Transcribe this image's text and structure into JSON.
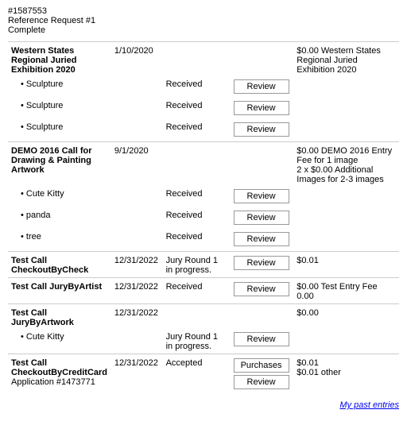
{
  "header": {
    "id": "#1587553",
    "reference": "Reference Request #1",
    "status": "Complete"
  },
  "entries": [
    {
      "id": "entry-western",
      "call_name": "Western States Regional Juried Exhibition 2020",
      "date": "1/10/2020",
      "status": "",
      "amount": "$0.00 Western States Regional Juried Exhibition 2020",
      "artworks": [
        {
          "name": "Sculpture",
          "status": "Received",
          "has_review": true
        },
        {
          "name": "Sculpture",
          "status": "Received",
          "has_review": true
        },
        {
          "name": "Sculpture",
          "status": "Received",
          "has_review": true
        }
      ]
    },
    {
      "id": "entry-demo",
      "call_name": "DEMO 2016 Call for Drawing & Painting Artwork",
      "date": "9/1/2020",
      "status": "",
      "amount": "$0.00 DEMO 2016 Entry Fee for 1 image\n2 x $0.00 Additional Images for 2-3 images",
      "artworks": [
        {
          "name": "Cute Kitty",
          "status": "Received",
          "has_review": true
        },
        {
          "name": "panda",
          "status": "Received",
          "has_review": true
        },
        {
          "name": "tree",
          "status": "Received",
          "has_review": true
        }
      ]
    },
    {
      "id": "entry-check",
      "call_name": "Test Call CheckoutByCheck",
      "date": "12/31/2022",
      "status": "Jury Round 1 in progress.",
      "amount": "$0.01",
      "artworks": [],
      "has_review": true
    },
    {
      "id": "entry-artist",
      "call_name": "Test Call JuryByArtist",
      "date": "12/31/2022",
      "status": "Received",
      "amount": "$0.00 Test Entry Fee 0.00",
      "artworks": [],
      "has_review": true
    },
    {
      "id": "entry-artwork",
      "call_name": "Test Call JuryByArtwork",
      "date": "12/31/2022",
      "status": "",
      "amount": "$0.00",
      "artworks": [
        {
          "name": "Cute Kitty",
          "status": "Jury Round 1 in progress.",
          "has_review": true
        }
      ]
    },
    {
      "id": "entry-cc",
      "call_name": "Test Call CheckoutByCreditCard",
      "date": "12/31/2022",
      "status": "Accepted",
      "application": "Application #1473771",
      "amount": "$0.01\n$0.01 other",
      "artworks": [],
      "has_purchases": true,
      "has_review": true
    }
  ],
  "footer": {
    "link_text": "My past entries"
  },
  "buttons": {
    "review": "Review",
    "purchases": "Purchases"
  }
}
